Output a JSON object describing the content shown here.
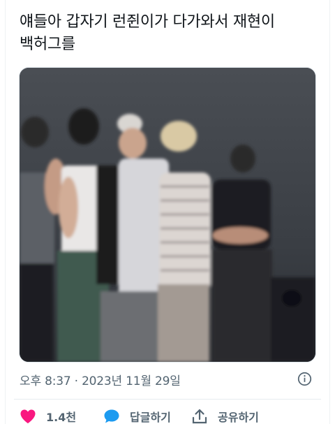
{
  "tweet": {
    "text": "얘들아 갑자기 런쥔이가 다가와서 재현이\n백허그를",
    "media_alt": "video frame",
    "timestamp": "오후 8:37 · 2023년 11월 29일"
  },
  "actions": {
    "like_count": "1.4천",
    "reply_label": "답글하기",
    "share_label": "공유하기"
  },
  "colors": {
    "like": "#f91880",
    "reply": "#1d9bf0",
    "secondary_text": "#536471"
  },
  "icons": {
    "like": "heart-icon",
    "reply": "speech-bubble-icon",
    "share": "share-upload-icon",
    "info": "info-icon"
  }
}
